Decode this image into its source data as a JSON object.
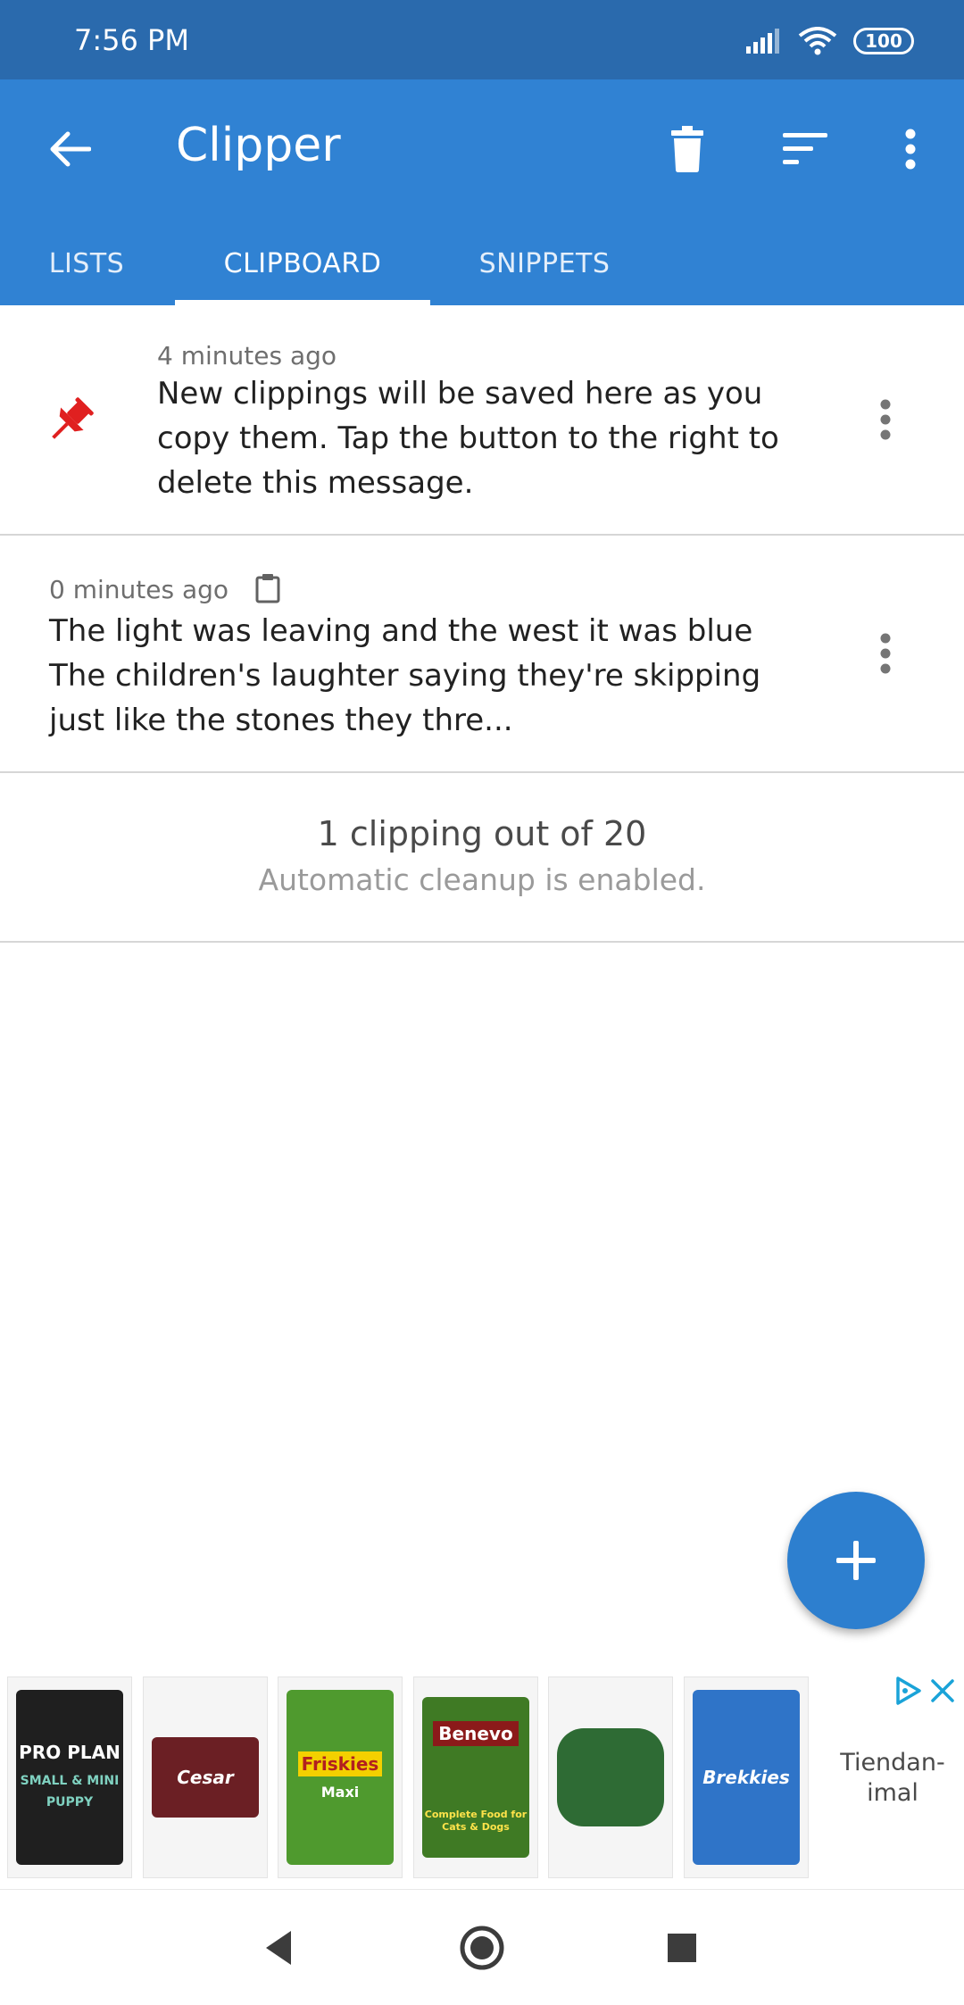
{
  "status_bar": {
    "time": "7:56 PM",
    "battery": "100"
  },
  "app_bar": {
    "title": "Clipper"
  },
  "tabs": [
    {
      "label": "LISTS",
      "active": false
    },
    {
      "label": "CLIPBOARD",
      "active": true
    },
    {
      "label": "SNIPPETS",
      "active": false
    }
  ],
  "clippings": [
    {
      "time": "4 minutes ago",
      "pinned": true,
      "text_lines": [
        "New clippings will be saved here as you",
        "copy them. Tap the button to the right to",
        "delete this message."
      ]
    },
    {
      "time": "0 minutes ago",
      "pinned": false,
      "text_lines": [
        "The light was leaving and the west it was blue",
        "The children's laughter saying they're skipping",
        "just like the stones they thre..."
      ]
    }
  ],
  "summary": {
    "count_text": "1 clipping out of 20",
    "cleanup_text": "Automatic cleanup is enabled."
  },
  "ad": {
    "products": [
      {
        "name": "PRO PLAN",
        "sub": "SMALL & MINI PUPPY",
        "color": "#1f1f1f"
      },
      {
        "name": "Cesar",
        "sub": "",
        "color": "#6b1f24"
      },
      {
        "name": "Friskies",
        "sub": "Maxi",
        "color": "#4f9a2e"
      },
      {
        "name": "Benevo",
        "sub": "Complete Food for Cats & Dogs",
        "color": "#3f7a24"
      },
      {
        "name": "",
        "sub": "",
        "color": "#2e6b34"
      },
      {
        "name": "Brekkies",
        "sub": "",
        "color": "#2f74c8"
      }
    ],
    "brand_lines": [
      "Tiendan-",
      "imal"
    ]
  },
  "colors": {
    "status_bar": "#2a6aad",
    "app_bar": "#3082d3",
    "fab": "#2d7fcf",
    "pin": "#e02020"
  }
}
